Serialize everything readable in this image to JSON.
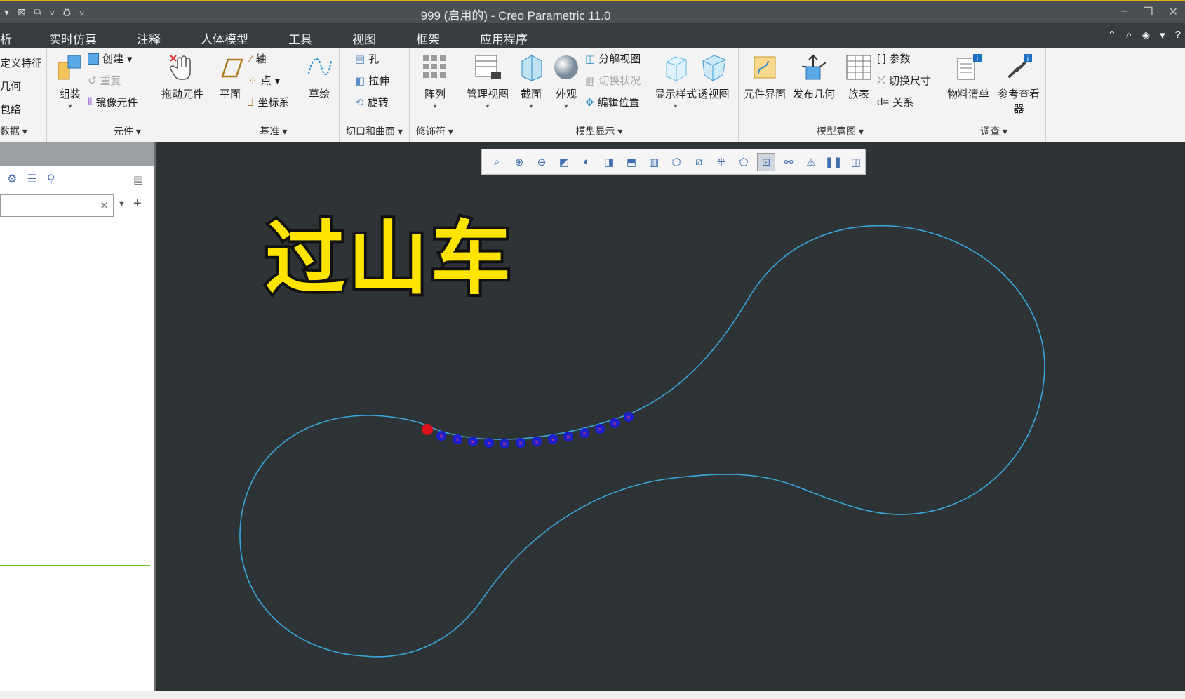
{
  "window": {
    "title": "999 (启用的) - Creo Parametric 11.0",
    "controls": [
      "minimize-icon",
      "restore-icon",
      "close-icon"
    ]
  },
  "menu": {
    "tabs": [
      "析",
      "实时仿真",
      "注释",
      "人体模型",
      "工具",
      "视图",
      "框架",
      "应用程序"
    ]
  },
  "ribbon": {
    "groups": {
      "data": {
        "label": "数据",
        "items": [
          "定义特征",
          "几何",
          "包络"
        ]
      },
      "component": {
        "label": "元件",
        "assemble": "组装",
        "create": "创建",
        "repeat": "重复",
        "mirror": "镜像元件",
        "drag": "拖动元件"
      },
      "datum": {
        "label": "基准",
        "plane": "平面",
        "axis": "轴",
        "point": "点",
        "csys": "坐标系",
        "sketch": "草绘"
      },
      "cut": {
        "label": "切口和曲面",
        "hole": "孔",
        "extrude": "拉伸",
        "revolve": "旋转"
      },
      "modifier": {
        "label": "修饰符",
        "pattern": "阵列"
      },
      "display": {
        "label": "模型显示",
        "manage": "管理视图",
        "section": "截面",
        "appearance": "外观",
        "explode": "分解视图",
        "toggle": "切换状况",
        "edit_pos": "编辑位置",
        "style": "显示样式",
        "perspective": "透视图"
      },
      "intent": {
        "label": "模型意图",
        "interface": "元件界面",
        "publish": "发布几何",
        "family": "族表",
        "params": "参数",
        "switch_dim": "切换尺寸",
        "relations": "关系"
      },
      "investigate": {
        "label": "调查",
        "bom": "物料清单",
        "ref_viewer_1": "参考查看",
        "ref_viewer_2": "器"
      }
    }
  },
  "overlay": {
    "title": "过山车"
  },
  "colors": {
    "track": "#3aa7d9",
    "bead": "#1a1fd0",
    "bead_mark": "#ff3b6b",
    "lead": "#e0101c",
    "title": "#ffe400"
  }
}
